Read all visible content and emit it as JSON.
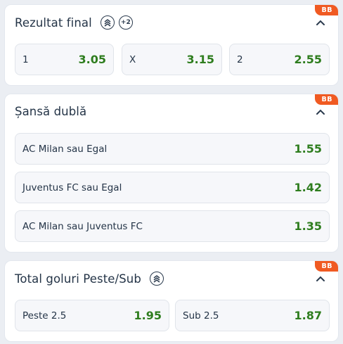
{
  "colors": {
    "odd_green": "#2e7d1e",
    "bb_badge": "#f05a22",
    "background": "#ebeef3"
  },
  "markets": [
    {
      "title": "Rezultat final",
      "badge": "BB",
      "icons": [
        "bet-builder-icon",
        "more-markets-icon"
      ],
      "more_label": "+2",
      "selections": [
        {
          "label": "1",
          "odd": "3.05"
        },
        {
          "label": "X",
          "odd": "3.15"
        },
        {
          "label": "2",
          "odd": "2.55"
        }
      ]
    },
    {
      "title": "Șansă dublă",
      "badge": "BB",
      "selections": [
        {
          "label": "AC Milan sau Egal",
          "odd": "1.55"
        },
        {
          "label": "Juventus FC sau Egal",
          "odd": "1.42"
        },
        {
          "label": "AC Milan sau Juventus FC",
          "odd": "1.35"
        }
      ]
    },
    {
      "title": "Total goluri Peste/Sub",
      "badge": "BB",
      "icons": [
        "bet-builder-icon"
      ],
      "selections": [
        {
          "label": "Peste 2.5",
          "odd": "1.95"
        },
        {
          "label": "Sub 2.5",
          "odd": "1.87"
        }
      ]
    }
  ]
}
